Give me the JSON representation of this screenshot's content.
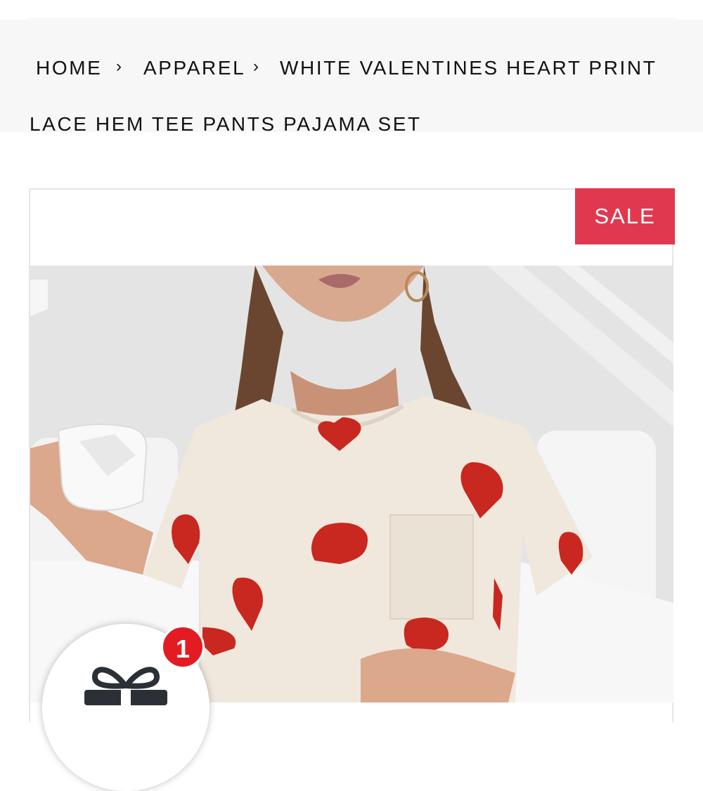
{
  "breadcrumb": {
    "home": "HOME",
    "separator": "›",
    "category": "APPAREL",
    "product_line1": "WHITE VALENTINES HEART PRINT",
    "product_line2": "LACE HEM TEE PANTS PAJAMA SET"
  },
  "product": {
    "badge": "SALE",
    "image_icon": "product-photo"
  },
  "gift_widget": {
    "icon": "gift-icon",
    "count": "1"
  },
  "colors": {
    "sale_badge": "#e0394f",
    "count_badge": "#e31b23",
    "breadcrumb_bg": "#f7f7f7",
    "heart_red": "#c8281f"
  }
}
